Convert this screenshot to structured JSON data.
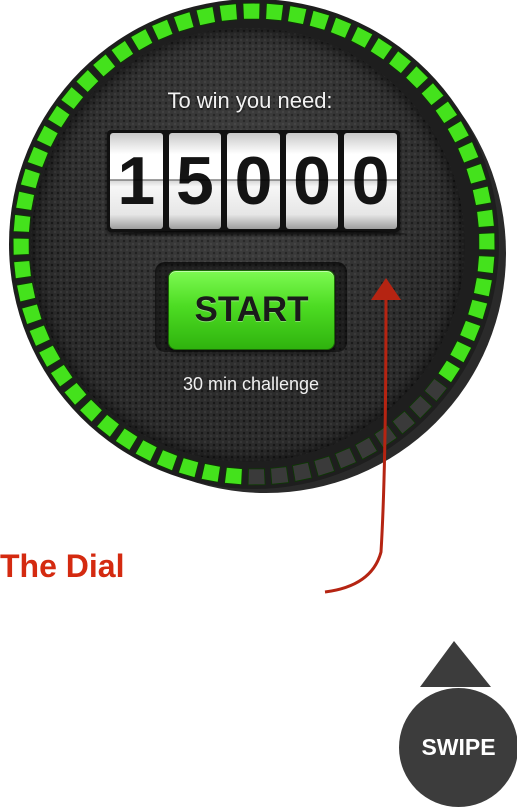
{
  "dial": {
    "need_label": "To win you need:",
    "digits": [
      "1",
      "5",
      "0",
      "0",
      "0"
    ],
    "start_label": "START",
    "challenge_label": "30 min challenge",
    "progress_segments_total": 64,
    "progress_segments_lit": 54,
    "colors": {
      "segment_lit": "#44e21c",
      "segment_unlit": "#3a3a3a",
      "button": "#3fd41a",
      "arrow": "#b52412"
    }
  },
  "annotation": {
    "caption": "The Dial"
  },
  "swipe": {
    "label": "SWIPE",
    "icon": "triangle-up-icon"
  }
}
